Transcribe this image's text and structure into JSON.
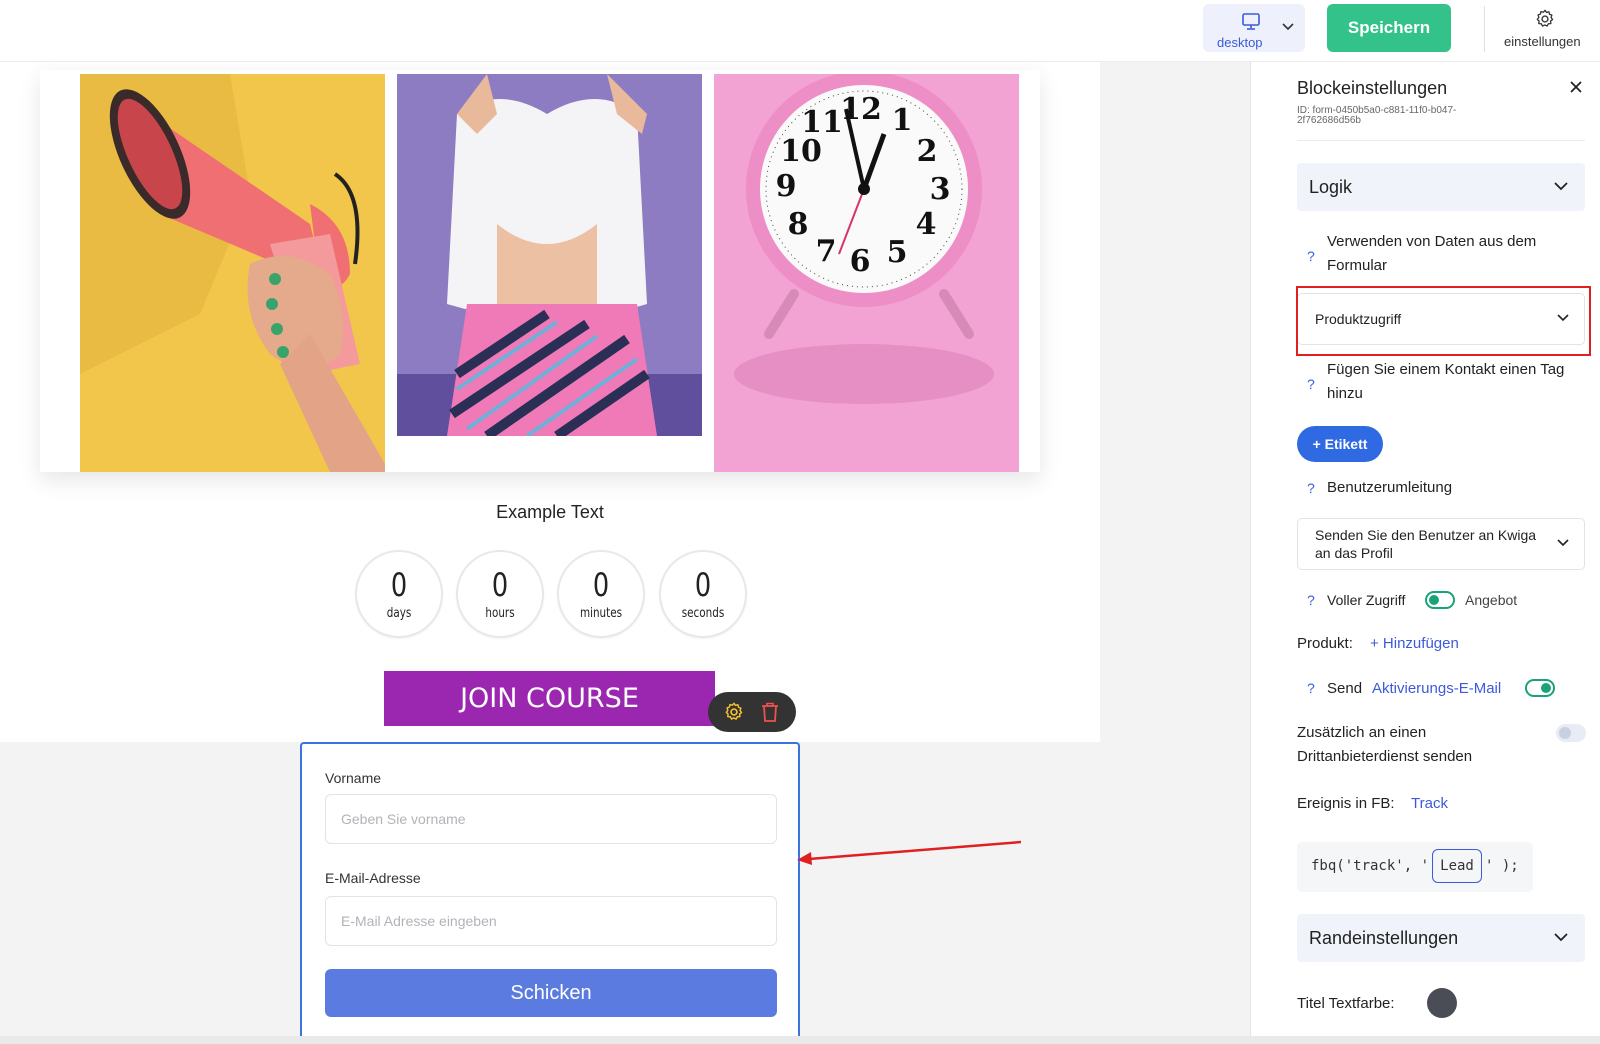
{
  "topbar": {
    "device_label": "desktop",
    "save_label": "Speichern",
    "settings_label": "einstellungen"
  },
  "canvas": {
    "example_text": "Example Text",
    "countdown": [
      {
        "value": "0",
        "unit": "days"
      },
      {
        "value": "0",
        "unit": "hours"
      },
      {
        "value": "0",
        "unit": "minutes"
      },
      {
        "value": "0",
        "unit": "seconds"
      }
    ],
    "join_label": "JOIN COURSE",
    "form": {
      "first_name_label": "Vorname",
      "first_name_placeholder": "Geben Sie vorname",
      "email_label": "E-Mail-Adresse",
      "email_placeholder": "E-Mail Adresse eingeben",
      "submit_label": "Schicken"
    }
  },
  "panel": {
    "title": "Blockeinstellungen",
    "block_id": "ID: form-0450b5a0-c881-11f0-b047-2f762686d56b",
    "logic_label": "Logik",
    "use_data_label": "Verwenden von Daten aus dem Formular",
    "product_access_value": "Produktzugriff",
    "add_tag_label": "Fügen Sie einem Kontakt einen Tag hinzu",
    "tag_button_label": "+ Etikett",
    "redirect_label": "Benutzerumleitung",
    "redirect_value": "Senden Sie den Benutzer an Kwiga an das Profil",
    "full_access_label": "Voller Zugriff",
    "offer_label": "Angebot",
    "product_label": "Produkt:",
    "add_link": "+ Hinzufügen",
    "send_label": "Send",
    "activation_email_link": "Aktivierungs-E-Mail",
    "third_party_label": "Zusätzlich an einen Drittanbieterdienst senden",
    "fb_event_label": "Ereignis in FB:",
    "fb_track_link": "Track",
    "fb_code_prefix": "fbq('track', '",
    "fb_code_value": "Lead",
    "fb_code_suffix": "' );",
    "border_settings_label": "Randeinstellungen",
    "title_color_label": "Titel Textfarbe:",
    "qmark": "?"
  },
  "colors": {
    "accent_green": "#33c28a",
    "join_purple": "#9b27b0",
    "submit_blue": "#5b7be0",
    "tag_blue": "#2f6ae3",
    "highlight_red": "#e02020",
    "title_color_swatch": "#4a4d55"
  }
}
